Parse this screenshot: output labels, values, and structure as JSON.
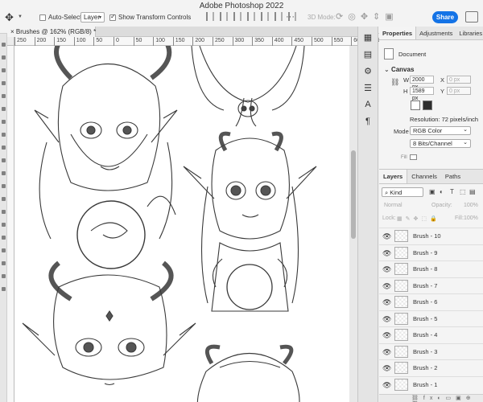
{
  "app": {
    "title": "Adobe Photoshop 2022"
  },
  "options_bar": {
    "auto_select_label": "Auto-Select:",
    "auto_select_target": "Layer",
    "show_transform_label": "Show Transform Controls",
    "more_label": "···",
    "mode_3d_label": "3D Mode:",
    "share_label": "Share"
  },
  "document": {
    "tab_label": "Brushes @ 162% (RGB/8) *",
    "ruler_ticks": [
      "250",
      "200",
      "150",
      "100",
      "50",
      "0",
      "50",
      "100",
      "150",
      "200",
      "250",
      "300",
      "350",
      "400",
      "450",
      "500",
      "550",
      "600",
      "650",
      "700",
      "750"
    ]
  },
  "properties": {
    "tabs": [
      "Properties",
      "Adjustments",
      "Libraries"
    ],
    "active_tab": "Properties",
    "doc_label": "Document",
    "canvas_label": "Canvas",
    "width_label": "W",
    "width_value": "2000 px",
    "height_label": "H",
    "height_value": "1589 px",
    "x_label": "X",
    "x_value": "0 px",
    "y_label": "Y",
    "y_value": "0 px",
    "resolution": "Resolution: 72 pixels/inch",
    "mode_label": "Mode",
    "mode_value": "RGB Color",
    "depth_value": "8 Bits/Channel",
    "fill_label": "Fill"
  },
  "layers": {
    "tabs": [
      "Layers",
      "Channels",
      "Paths"
    ],
    "active_tab": "Layers",
    "kind_label": "Kind",
    "blend_mode": "Normal",
    "opacity_label": "Opacity:",
    "opacity_value": "100%",
    "lock_label": "Lock:",
    "fill_label": "Fill:",
    "fill_value": "100%",
    "items": [
      "Brush - 10",
      "Brush - 9",
      "Brush - 8",
      "Brush - 7",
      "Brush - 6",
      "Brush - 5",
      "Brush - 4",
      "Brush - 3",
      "Brush - 2",
      "Brush - 1"
    ]
  },
  "colors": {
    "accent": "#1473e6",
    "panel_bg": "#f4f4f4",
    "canvas_bg": "#ffffff"
  }
}
